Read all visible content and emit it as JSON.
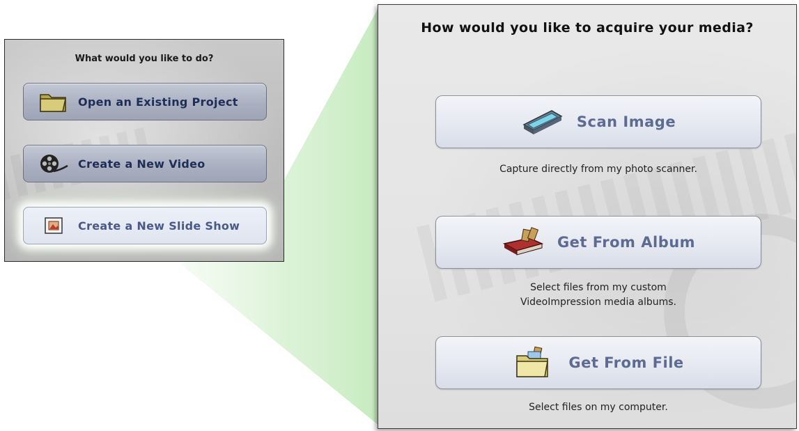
{
  "left_panel": {
    "title": "What would you like to do?",
    "buttons": [
      {
        "label": "Open an Existing Project",
        "icon": "folder-icon"
      },
      {
        "label": "Create a New Video",
        "icon": "film-reel-icon"
      },
      {
        "label": "Create a New Slide Show",
        "icon": "slideshow-icon",
        "selected": true
      }
    ]
  },
  "right_panel": {
    "title": "How would you like to acquire your media?",
    "options": [
      {
        "label": "Scan Image",
        "icon": "scanner-icon",
        "description_lines": [
          "Capture directly from my photo scanner."
        ]
      },
      {
        "label": "Get From Album",
        "icon": "photo-album-icon",
        "description_lines": [
          "Select files from my custom",
          "VideoImpression media albums."
        ]
      },
      {
        "label": "Get From File",
        "icon": "file-folder-icon",
        "description_lines": [
          "Select files on my computer."
        ]
      }
    ]
  },
  "colors": {
    "button_text_dark": "#1f2e58",
    "button_text_light": "#5d6b92",
    "highlight_beam": "#cfeec9"
  }
}
